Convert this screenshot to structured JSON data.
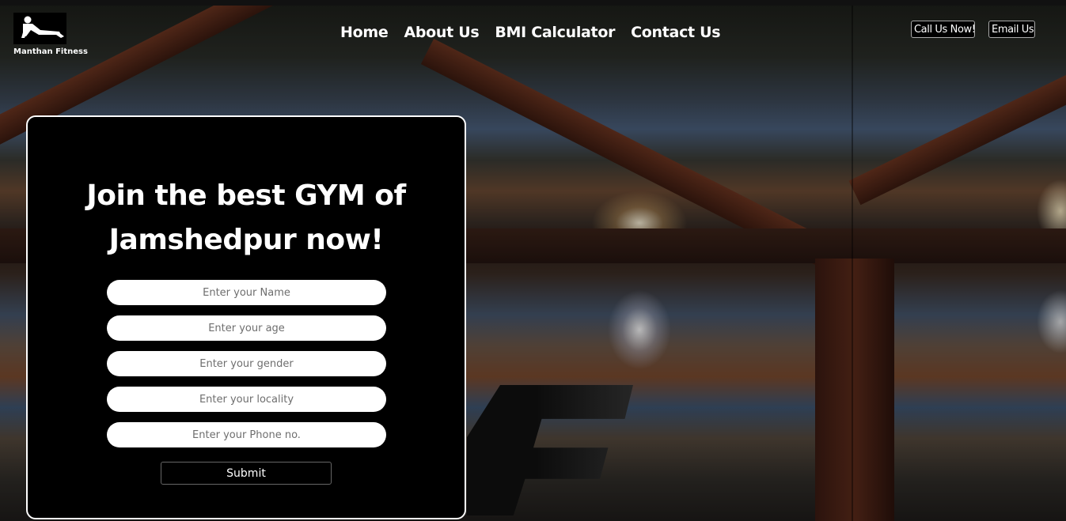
{
  "brand": {
    "name": "Manthan Fitness",
    "logo_icon": "pushup-person-icon"
  },
  "nav": {
    "items": [
      {
        "label": "Home"
      },
      {
        "label": "About Us"
      },
      {
        "label": "BMI Calculator"
      },
      {
        "label": "Contact Us"
      }
    ]
  },
  "header_actions": {
    "call_label": "Call Us Now!",
    "email_label": "Email Us"
  },
  "signup_form": {
    "title_line1": "Join the best GYM of",
    "title_line2": "Jamshedpur now!",
    "fields": [
      {
        "placeholder": "Enter your Name",
        "value": ""
      },
      {
        "placeholder": "Enter your age",
        "value": ""
      },
      {
        "placeholder": "Enter your gender",
        "value": ""
      },
      {
        "placeholder": "Enter your locality",
        "value": ""
      },
      {
        "placeholder": "Enter your Phone no.",
        "value": ""
      }
    ],
    "submit_label": "Submit"
  },
  "colors": {
    "page_bg": "#000000",
    "card_bg": "#000000",
    "card_border": "#ffffff",
    "text": "#ffffff"
  }
}
